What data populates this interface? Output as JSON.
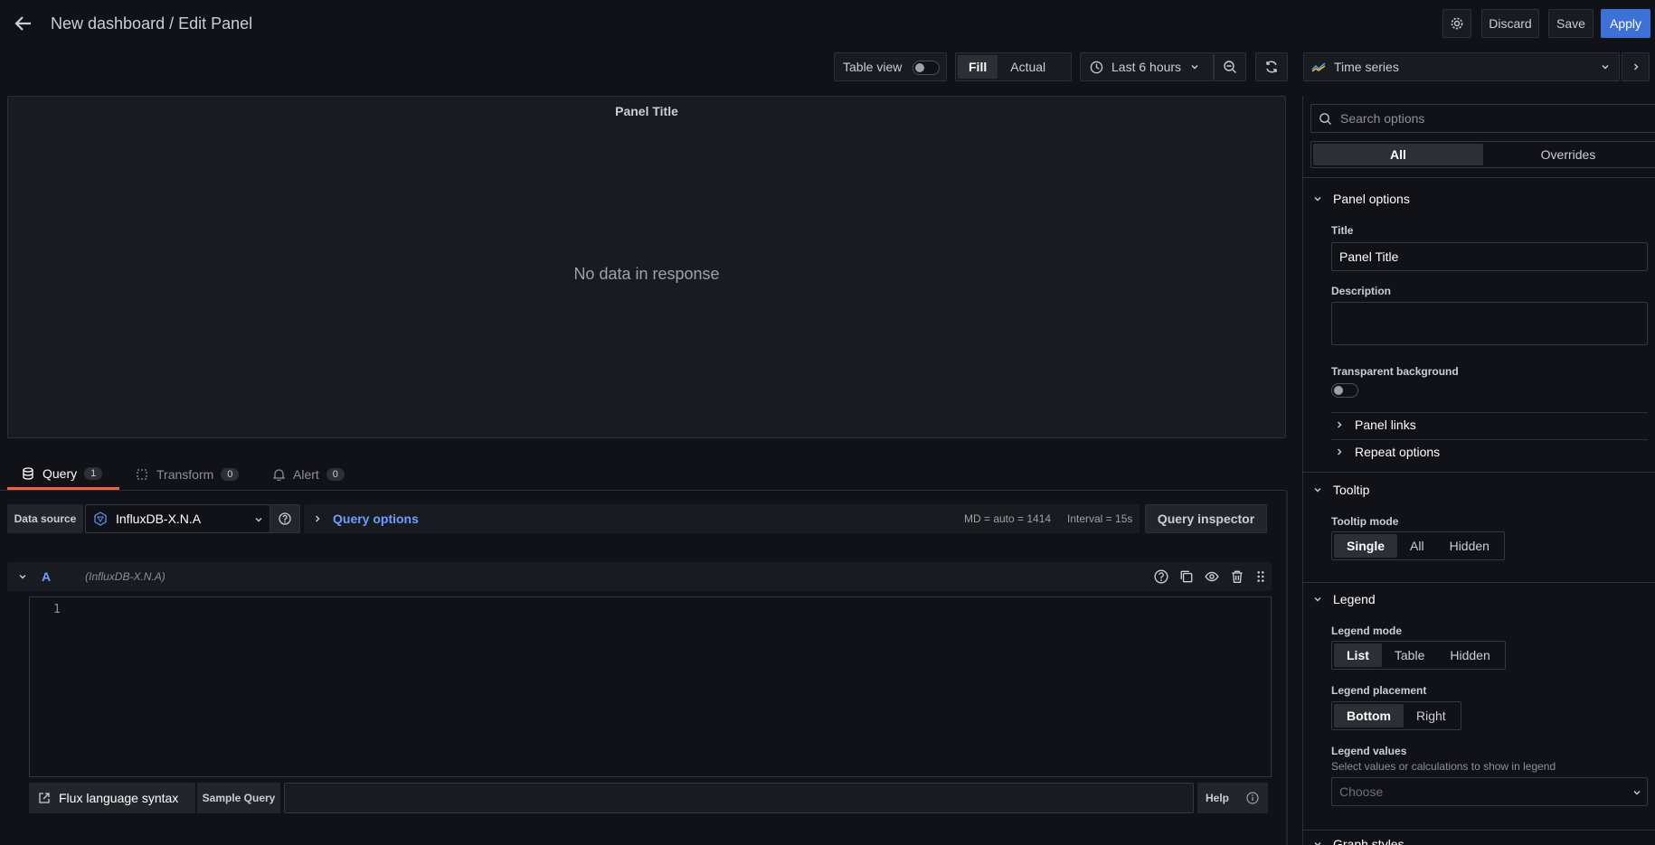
{
  "header": {
    "title": "New dashboard / Edit Panel",
    "discard_label": "Discard",
    "save_label": "Save",
    "apply_label": "Apply"
  },
  "toolbar": {
    "table_view_label": "Table view",
    "fill_label": "Fill",
    "actual_label": "Actual",
    "time_range_label": "Last 6 hours",
    "visualization_label": "Time series"
  },
  "preview": {
    "panel_title": "Panel Title",
    "empty_message": "No data in response"
  },
  "tabs": [
    {
      "label": "Query",
      "count": "1"
    },
    {
      "label": "Transform",
      "count": "0"
    },
    {
      "label": "Alert",
      "count": "0"
    }
  ],
  "query_bar": {
    "datasource_label": "Data source",
    "datasource_value": "InfluxDB-X.N.A",
    "query_options_label": "Query options",
    "md_info": "MD = auto = 1414",
    "interval_info": "Interval = 15s",
    "inspector_label": "Query inspector"
  },
  "query_row": {
    "ref_id": "A",
    "datasource_hint": "(InfluxDB-X.N.A)",
    "line_number": "1"
  },
  "editor_footer": {
    "flux_syntax_label": "Flux language syntax",
    "sample_query_label": "Sample Query",
    "help_label": "Help"
  },
  "options": {
    "search_placeholder": "Search options",
    "tab_all": "All",
    "tab_overrides": "Overrides",
    "panel_options": {
      "heading": "Panel options",
      "title_label": "Title",
      "title_value": "Panel Title",
      "description_label": "Description",
      "transparent_label": "Transparent background",
      "panel_links_label": "Panel links",
      "repeat_options_label": "Repeat options"
    },
    "tooltip": {
      "heading": "Tooltip",
      "mode_label": "Tooltip mode",
      "modes": [
        "Single",
        "All",
        "Hidden"
      ]
    },
    "legend": {
      "heading": "Legend",
      "mode_label": "Legend mode",
      "modes": [
        "List",
        "Table",
        "Hidden"
      ],
      "placement_label": "Legend placement",
      "placements": [
        "Bottom",
        "Right"
      ],
      "values_label": "Legend values",
      "values_desc": "Select values or calculations to show in legend",
      "values_placeholder": "Choose"
    },
    "graph_styles_heading": "Graph styles"
  },
  "colors": {
    "background": "#111217",
    "panel": "#181b1f",
    "primary": "#3d71d9",
    "accent_orange": "#f55f3e",
    "link_blue": "#6e9fff"
  }
}
